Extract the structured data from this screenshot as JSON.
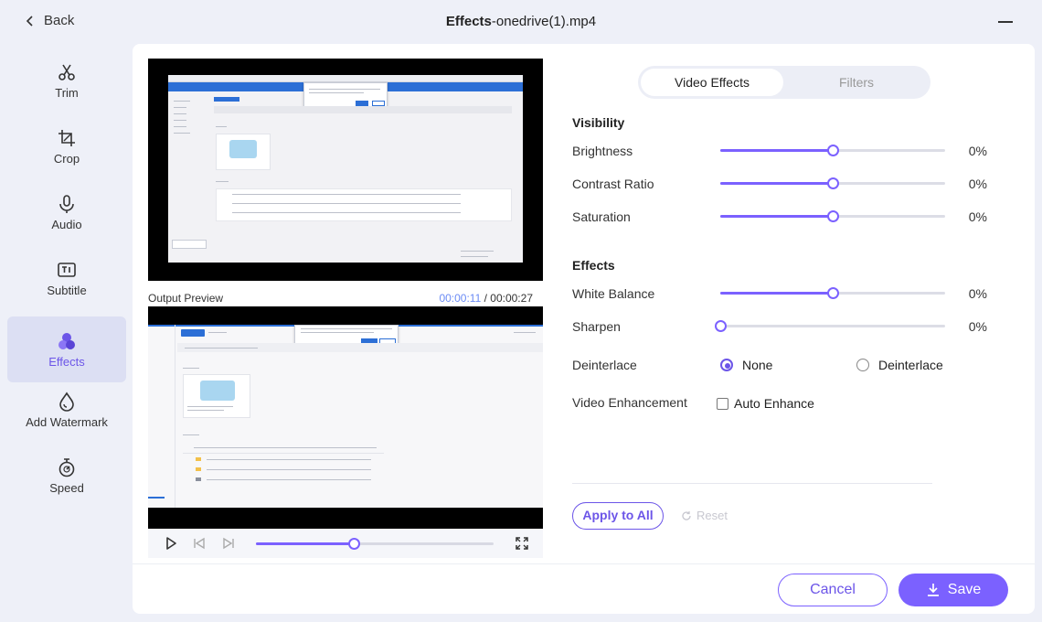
{
  "header": {
    "back_label": "Back",
    "title_bold": "Effects",
    "title_rest": "-onedrive(1).mp4"
  },
  "sidebar": {
    "items": [
      {
        "label": "Trim",
        "icon": "scissors-icon"
      },
      {
        "label": "Crop",
        "icon": "crop-icon"
      },
      {
        "label": "Audio",
        "icon": "microphone-icon"
      },
      {
        "label": "Subtitle",
        "icon": "subtitle-icon"
      },
      {
        "label": "Effects",
        "icon": "effects-icon",
        "active": true
      },
      {
        "label": "Add Watermark",
        "icon": "watermark-icon"
      },
      {
        "label": "Speed",
        "icon": "stopwatch-icon"
      }
    ]
  },
  "preview": {
    "output_label": "Output Preview",
    "current_time": "00:00:11",
    "separator": " / ",
    "total_time": "00:00:27",
    "progress": 0.41
  },
  "tabs": [
    {
      "label": "Video Effects",
      "active": true
    },
    {
      "label": "Filters",
      "active": false
    }
  ],
  "visibility": {
    "title": "Visibility",
    "rows": [
      {
        "label": "Brightness",
        "value": "0%",
        "level": 0.5
      },
      {
        "label": "Contrast Ratio",
        "value": "0%",
        "level": 0.5
      },
      {
        "label": "Saturation",
        "value": "0%",
        "level": 0.5
      }
    ]
  },
  "effects": {
    "title": "Effects",
    "rows": [
      {
        "label": "White Balance",
        "value": "0%",
        "level": 0.5
      },
      {
        "label": "Sharpen",
        "value": "0%",
        "level": 0.0
      }
    ]
  },
  "deinterlace": {
    "label": "Deinterlace",
    "options": [
      {
        "label": "None",
        "selected": true
      },
      {
        "label": "Deinterlace",
        "selected": false
      }
    ]
  },
  "enhancement": {
    "label": "Video Enhancement",
    "checkbox_label": "Auto Enhance",
    "checked": false
  },
  "actions": {
    "apply_all": "Apply to All",
    "reset": "Reset",
    "cancel": "Cancel",
    "save": "Save"
  },
  "colors": {
    "accent": "#7b61ff",
    "accent_dark": "#6c55e8",
    "active_tab_bg": "#dcdff3"
  }
}
